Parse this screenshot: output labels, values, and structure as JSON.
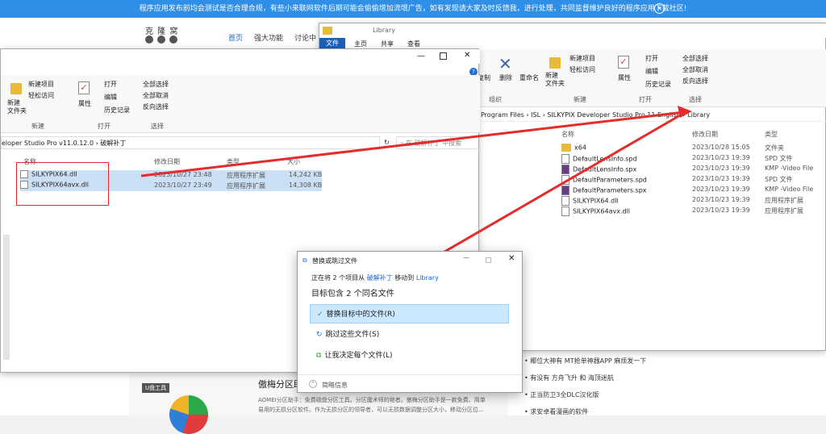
{
  "banner": {
    "text": "程序应用发布前均会测试是否合理合规，有些小来联网软件后期可能会偷偷增加流氓广告，如有发现请大家及时反馈我，进行处理，共同监督维护良好的程序应用下载社区!"
  },
  "site": {
    "logo": "克 隆 窝",
    "nav": [
      "首页",
      "强大功能",
      "讨论中"
    ],
    "right_links": [
      "椰位大神有 MT抢单神器APP 麻烦发一下",
      "有没有 方舟飞升 和 海顶迷航",
      "正当防卫3全DLC汉化版",
      "求安卓看漫画的软件"
    ],
    "badge": "U盘工具",
    "article_title": "傲梅分区助",
    "article_text1": "AOMEI分区助手：免费磁盘分区工具。分区魔术师的继者。傲梅分区助手是一款免费、简单",
    "article_text2": "易用的无损分区软件。作为无损分区的领导者，可以无损数据调整分区大小，移动分区位..."
  },
  "left_window": {
    "ribbon": {
      "new_item": "新建项目",
      "easy_access": "轻松访问",
      "new_folder": "新建\n文件夹",
      "new_group": "新建",
      "open": "打开",
      "edit": "编辑",
      "history": "历史记录",
      "properties": "属性",
      "open_group": "打开",
      "select_all": "全部选择",
      "select_none": "全部取消",
      "invert": "反向选择",
      "select_group": "选择"
    },
    "path": "eloper Studio Pro v11.0.12.0 › 破解补丁",
    "search": "在 破解补丁 中搜索",
    "columns": [
      "名称",
      "修改日期",
      "类型",
      "大小"
    ],
    "files": [
      {
        "name": "SILKYPIX64.dll",
        "date": "2023/10/27 23:48",
        "type": "应用程序扩展",
        "size": "14,242 KB"
      },
      {
        "name": "SILKYPIX64avx.dll",
        "date": "2023/10/27 23:49",
        "type": "应用程序扩展",
        "size": "14,308 KB"
      }
    ]
  },
  "right_window": {
    "title": "Library",
    "tabs": [
      "文件",
      "主页",
      "共享",
      "查看"
    ],
    "ribbon": {
      "copy": "复制",
      "delete": "删除",
      "rename": "重命名",
      "org": "组织",
      "new_folder": "新建\n文件夹",
      "new_item": "新建项目",
      "easy_access": "轻松访问",
      "new_group": "新建",
      "properties": "属性",
      "open": "打开",
      "edit": "编辑",
      "history": "历史记录",
      "open_group": "打开",
      "select_all": "全部选择",
      "select_none": "全部取消",
      "invert": "反向选择",
      "select_group": "选择"
    },
    "path": [
      "Program Files",
      "ISL",
      "SILKYPIX Developer Studio Pro 11 English",
      "Library"
    ],
    "columns": [
      "名称",
      "修改日期",
      "类型"
    ],
    "files": [
      {
        "name": "x64",
        "date": "2023/10/28 15:05",
        "type": "文件夹",
        "icon": "folder"
      },
      {
        "name": "DefaultLensInfo.spd",
        "date": "2023/10/23 19:39",
        "type": "SPD 文件",
        "icon": "file"
      },
      {
        "name": "DefaultLensInfo.spx",
        "date": "2023/10/23 19:39",
        "type": "KMP -Video File",
        "icon": "video"
      },
      {
        "name": "DefaultParameters.spd",
        "date": "2023/10/23 19:39",
        "type": "SPD 文件",
        "icon": "file"
      },
      {
        "name": "DefaultParameters.spx",
        "date": "2023/10/23 19:39",
        "type": "KMP -Video File",
        "icon": "video"
      },
      {
        "name": "SILKYPIX64.dll",
        "date": "2023/10/23 19:39",
        "type": "应用程序扩展",
        "icon": "dll"
      },
      {
        "name": "SILKYPIX64avx.dll",
        "date": "2023/10/23 19:39",
        "type": "应用程序扩展",
        "icon": "dll"
      }
    ]
  },
  "dialog": {
    "title": "替换或跳过文件",
    "info_prefix": "正在将 2 个项目从",
    "from": "破解补丁",
    "mid": "移动到",
    "to": "Library",
    "heading": "目标包含 2 个同名文件",
    "options": [
      "替换目标中的文件(R)",
      "跳过这些文件(S)",
      "让我决定每个文件(L)"
    ],
    "details": "简略信息"
  },
  "colors": {
    "banner": "#2f8ee6",
    "arrow": "#e52b2b",
    "selection": "#cce0f5",
    "link": "#1a66c8"
  }
}
